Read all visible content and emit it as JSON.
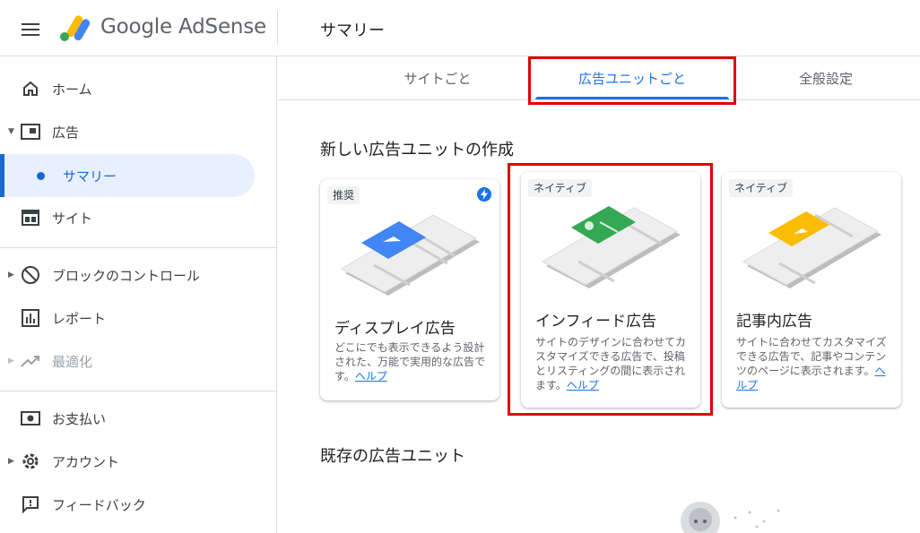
{
  "header": {
    "menu_icon": "hamburger-menu-icon",
    "product_name": "Google AdSense",
    "page_title": "サマリー"
  },
  "sidebar": {
    "items": [
      {
        "label": "ホーム",
        "icon": "home-icon"
      },
      {
        "label": "広告",
        "icon": "ad-frame-icon"
      },
      {
        "label": "サマリー",
        "icon": "dot"
      },
      {
        "label": "サイト",
        "icon": "site-browser-icon"
      },
      {
        "label": "ブロックのコントロール",
        "icon": "block-icon"
      },
      {
        "label": "レポート",
        "icon": "report-chart-icon"
      },
      {
        "label": "最適化",
        "icon": "trending-up-icon"
      },
      {
        "label": "お支払い",
        "icon": "payments-icon"
      },
      {
        "label": "アカウント",
        "icon": "gear-icon"
      },
      {
        "label": "フィードバック",
        "icon": "feedback-icon"
      }
    ],
    "active_color": "#1967d2",
    "active_bg": "#e8f0fe"
  },
  "tabs": [
    {
      "label": "サイトごと"
    },
    {
      "label": "広告ユニットごと",
      "selected": true
    },
    {
      "label": "全般設定"
    }
  ],
  "main": {
    "new_units_heading": "新しい広告ユニットの作成",
    "existing_units_heading": "既存の広告ユニット",
    "cards": [
      {
        "badge": "推奨",
        "title": "ディスプレイ広告",
        "desc": "どこにでも表示できるよう設計された、万能で実用的な広告です。",
        "help": "ヘルプ",
        "art_color": "#4285f4"
      },
      {
        "badge": "ネイティブ",
        "title": "インフィード広告",
        "desc": "サイトのデザインに合わせてカスタマイズできる広告で、投稿とリスティングの間に表示されます。",
        "help": "ヘルプ",
        "art_color": "#34a853"
      },
      {
        "badge": "ネイティブ",
        "title": "記事内広告",
        "desc": "サイトに合わせてカスタマイズできる広告で、記事やコンテンツのページに表示されます。",
        "help": "ヘルプ",
        "art_color": "#fbbc04"
      }
    ]
  },
  "highlight_color": "#e00000"
}
